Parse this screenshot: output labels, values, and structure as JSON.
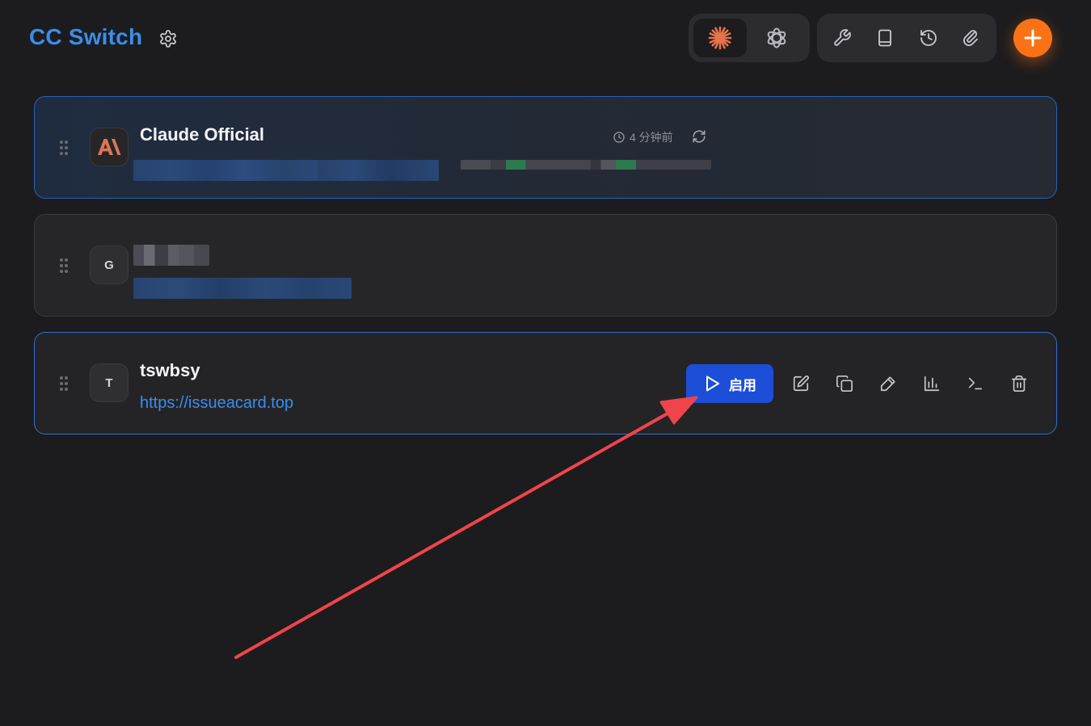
{
  "header": {
    "title": "CC Switch",
    "settings_icon": "gear-icon",
    "app_tabs": [
      {
        "name": "claude",
        "icon": "claude-sparkle-icon",
        "active": true
      },
      {
        "name": "codex",
        "icon": "openai-icon",
        "active": false
      }
    ],
    "tools": [
      {
        "icon": "wrench-icon"
      },
      {
        "icon": "book-icon"
      },
      {
        "icon": "history-icon"
      },
      {
        "icon": "paperclip-icon"
      }
    ],
    "add_icon": "plus-icon",
    "colors": {
      "accent": "#3b8eea",
      "add_button": "#f97316",
      "claude_orange": "#e8734a"
    }
  },
  "providers": [
    {
      "avatar_letter": "",
      "avatar_icon": "anthropic-logo-icon",
      "name": "Claude Official",
      "url": "",
      "current": true,
      "usage_time": "4 分钟前",
      "redacted": true
    },
    {
      "avatar_letter": "G",
      "name": "",
      "url": "",
      "current": false,
      "redacted": true
    },
    {
      "avatar_letter": "T",
      "name": "tswbsy",
      "url": "https://issueacard.top",
      "current": false,
      "hovered": true,
      "actions": {
        "enable_label": "启用",
        "icons": [
          "edit-icon",
          "duplicate-icon",
          "test-icon",
          "usage-chart-icon",
          "terminal-icon",
          "trash-icon"
        ]
      }
    }
  ],
  "annotation": {
    "type": "red-arrow",
    "color": "#f0444c"
  }
}
